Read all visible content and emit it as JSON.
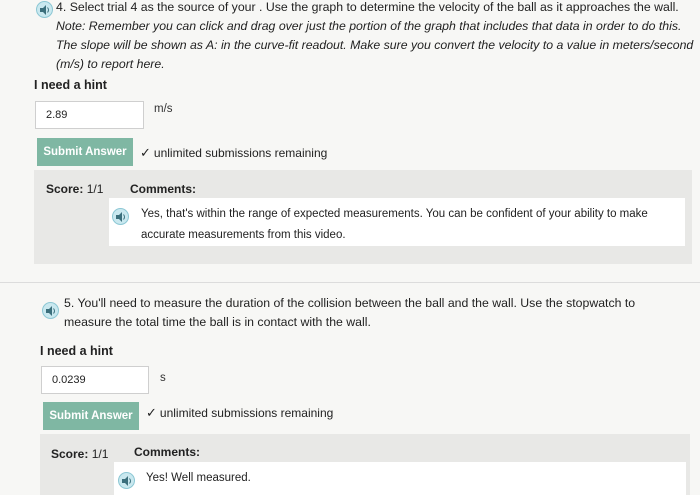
{
  "q4": {
    "number": "4.",
    "text": "Select trial 4 as the source of your . Use the graph to determine the velocity of the ball as it approaches the wall.",
    "note": "Note: Remember you can click and drag over just the portion of the graph that includes that data in order to do this. The slope will be shown as A: in the curve-fit readout. Make sure you convert the velocity to a value in meters/second (m/s) to report here.",
    "hint": "I need a hint",
    "answer": "2.89",
    "unit": "m/s",
    "submit_label": "Submit Answer",
    "remaining": "unlimited submissions remaining",
    "score_label": "Score:",
    "score_value": "1/1",
    "comments_label": "Comments:",
    "feedback": "Yes, that's within the range of expected measurements. You can be confident of your ability to make accurate measurements from this video."
  },
  "q5": {
    "number": "5.",
    "text": "You'll need to measure the duration of the collision between the ball and the wall. Use the stopwatch to measure the total time the ball is in contact with the wall.",
    "hint": "I need a hint",
    "answer": "0.0239",
    "unit": "s",
    "submit_label": "Submit Answer",
    "remaining": "unlimited submissions remaining",
    "score_label": "Score:",
    "score_value": "1/1",
    "comments_label": "Comments:",
    "feedback": "Yes! Well measured."
  },
  "icons": {
    "audio": "speaker-icon",
    "check": "checkmark-icon"
  },
  "colors": {
    "submit_bg": "#7fb7a3",
    "panel_bg": "#e8e8e6",
    "speaker_bg": "#c9e8ef"
  }
}
